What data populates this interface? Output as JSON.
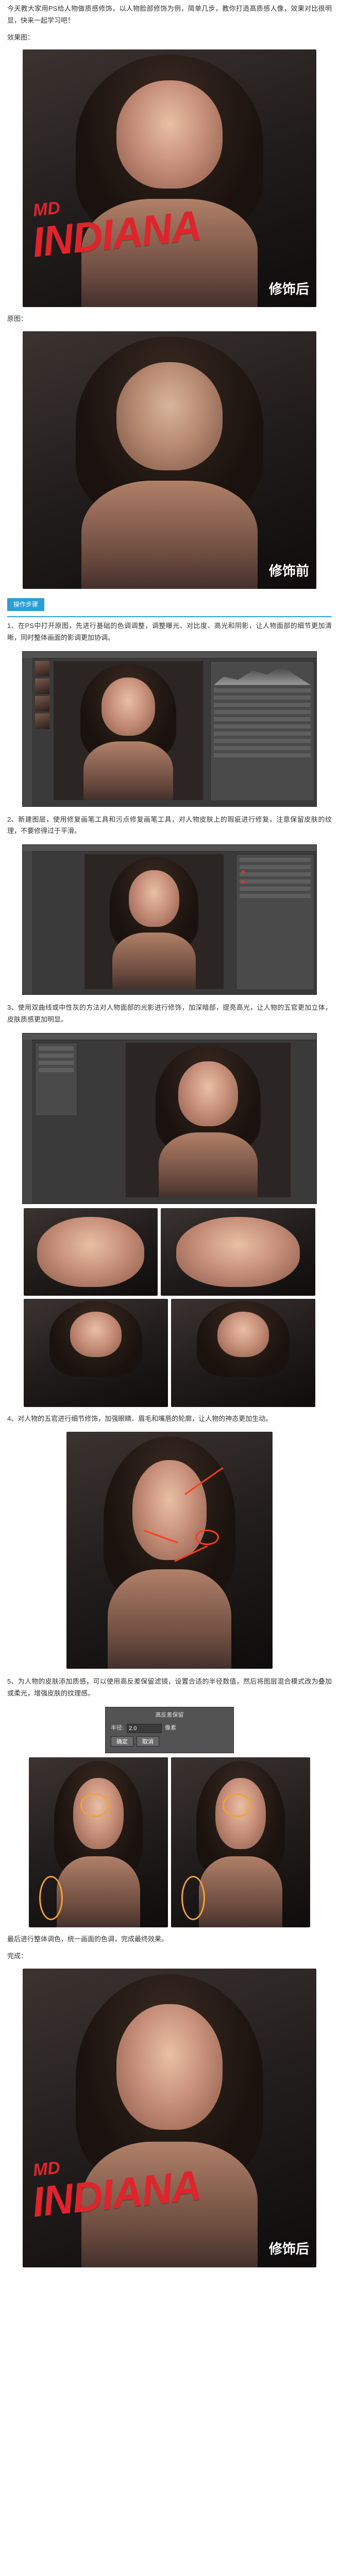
{
  "intro": {
    "text": "今天教大家用PS给人物做质感修饰，以人物脸部修饰为例，简单几步，教你打造高质感人像，效果对比很明显，快来一起学习吧！",
    "caption": "效果图："
  },
  "hero": {
    "brand_small": "MD",
    "brand_big": "INDIANA",
    "stamp": "修饰后"
  },
  "before": {
    "caption": "原图：",
    "stamp": "修饰前"
  },
  "section": {
    "title": "操作步骤"
  },
  "steps": [
    {
      "text": "1、在PS中打开原图，先进行基础的色调调整，调整曝光、对比度、高光和阴影，让人物面部的细节更加清晰，同时整体画面的影调更加协调。"
    },
    {
      "text": "2、新建图层，使用修复画笔工具和污点修复画笔工具，对人物皮肤上的瑕疵进行修复，注意保留皮肤的纹理，不要修得过于平滑。"
    },
    {
      "text": "3、使用双曲线或中性灰的方法对人物面部的光影进行修饰，加深暗部，提亮高光，让人物的五官更加立体，皮肤质感更加明显。"
    },
    {
      "text": "4、对人物的五官进行细节修饰，加强眼睛、眉毛和嘴唇的轮廓，让人物的神态更加生动。"
    },
    {
      "text": "5、为人物的皮肤添加质感，可以使用高反差保留滤镜，设置合适的半径数值，然后将图层混合模式改为叠加或柔光，增强皮肤的纹理感。"
    }
  ],
  "dialog": {
    "title": "高反差保留",
    "radius_label": "半径:",
    "radius_value": "2.0",
    "unit": "像素",
    "ok": "确定",
    "cancel": "取消"
  },
  "closing": {
    "text": "最后进行整体调色，统一画面的色调，完成最终效果。",
    "caption": "完成："
  },
  "final": {
    "brand_small": "MD",
    "brand_big": "INDIANA",
    "stamp": "修饰后"
  }
}
